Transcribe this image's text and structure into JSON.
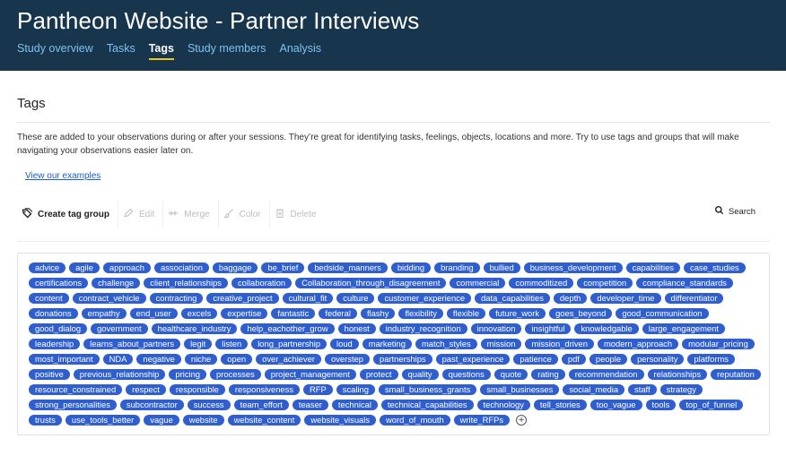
{
  "header": {
    "title": "Pantheon Website - Partner Interviews",
    "nav": [
      {
        "label": "Study overview",
        "active": false
      },
      {
        "label": "Tasks",
        "active": false
      },
      {
        "label": "Tags",
        "active": true
      },
      {
        "label": "Study members",
        "active": false
      },
      {
        "label": "Analysis",
        "active": false
      }
    ]
  },
  "section": {
    "title": "Tags",
    "description": "These are added to your observations during or after your sessions. They’re great for identifying tasks, feelings, objects, locations and more. Try to use tags and groups that will make navigating your observations easier later on.",
    "examples_link": "View our examples"
  },
  "toolbar": {
    "create_label": "Create tag group",
    "edit_label": "Edit",
    "merge_label": "Merge",
    "color_label": "Color",
    "delete_label": "Delete",
    "search_label": "Search"
  },
  "colors": {
    "header_bg": "#17354d",
    "nav_link": "#7fc1ee",
    "nav_active_underline": "#f0c419",
    "tag_bg": "#2f5fcf",
    "link": "#1a5fc7"
  },
  "tags": [
    "advice",
    "agile",
    "approach",
    "association",
    "baggage",
    "be_brief",
    "bedside_manners",
    "bidding",
    "branding",
    "bullied",
    "business_development",
    "capabilities",
    "case_studies",
    "certifications",
    "challenge",
    "client_relationships",
    "collaboration",
    "Collaboration_through_disagreement",
    "commercial",
    "commoditized",
    "competition",
    "compliance_standards",
    "content",
    "contract_vehicle",
    "contracting",
    "creative_project",
    "cultural_fit",
    "culture",
    "customer_experience",
    "data_capabilities",
    "depth",
    "developer_time",
    "differentiator",
    "donations",
    "empathy",
    "end_user",
    "excels",
    "expertise",
    "fantastic",
    "federal",
    "flashy",
    "flexibility",
    "flexible",
    "future_work",
    "goes_beyond",
    "good_communication",
    "good_dialog",
    "government",
    "healthcare_industry",
    "help_eachother_grow",
    "honest",
    "industry_recognition",
    "innovation",
    "insightful",
    "knowledgable",
    "large_engagement",
    "leadership",
    "learns_about_partners",
    "legit",
    "listen",
    "long_partnership",
    "loud",
    "marketing",
    "match_styles",
    "mission",
    "mission_driven",
    "modern_approach",
    "modular_pricing",
    "most_important",
    "NDA",
    "negative",
    "niche",
    "open",
    "over_achiever",
    "overstep",
    "partnerships",
    "past_experience",
    "patience",
    "pdf",
    "people",
    "personality",
    "platforms",
    "positive",
    "previous_relationship",
    "pricing",
    "processes",
    "project_management",
    "protect",
    "quality",
    "questions",
    "quote",
    "rating",
    "recommendation",
    "relationships",
    "reputation",
    "resource_constrained",
    "respect",
    "responsible",
    "responsiveness",
    "RFP",
    "scaling",
    "small_business_grants",
    "small_businesses",
    "social_media",
    "staff",
    "strategy",
    "strong_personalities",
    "subcontractor",
    "success",
    "team_effort",
    "teaser",
    "technical",
    "technical_capabilities",
    "technology",
    "tell_stories",
    "too_vague",
    "tools",
    "top_of_funnel",
    "trusts",
    "use_tools_better",
    "vague",
    "website",
    "website_content",
    "website_visuals",
    "word_of_mouth",
    "write_RFPs"
  ],
  "add_tag_icon": "plus-circle-icon"
}
